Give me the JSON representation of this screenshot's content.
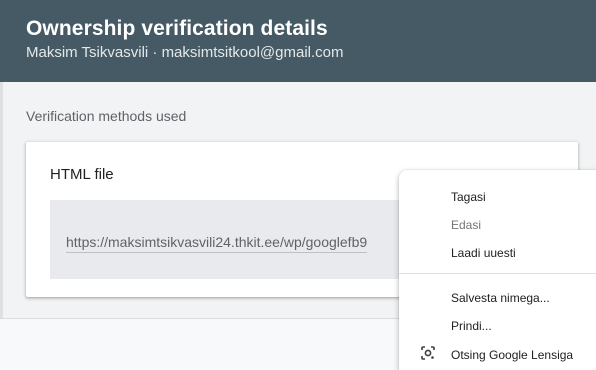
{
  "header": {
    "title": "Ownership verification details",
    "subtitle": "Maksim Tsikvasvili · maksimtsitkool@gmail.com"
  },
  "section": {
    "label": "Verification methods used"
  },
  "card": {
    "title": "HTML file",
    "url": "https://maksimtsikvasvili24.thkit.ee/wp/googlefb9"
  },
  "context_menu": {
    "items": [
      {
        "label": "Tagasi",
        "enabled": true
      },
      {
        "label": "Edasi",
        "enabled": false
      },
      {
        "label": "Laadi uuesti",
        "enabled": true
      },
      {
        "label": "Salvesta nimega...",
        "enabled": true
      },
      {
        "label": "Prindi...",
        "enabled": true
      },
      {
        "label": "Otsing Google Lensiga",
        "enabled": true,
        "icon": "lens-icon"
      }
    ]
  }
}
